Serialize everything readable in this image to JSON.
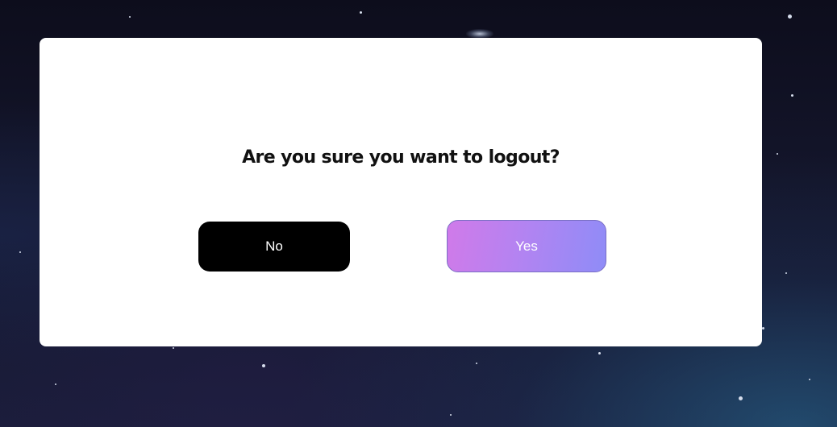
{
  "dialog": {
    "message": "Are you sure you want to logout?",
    "no_label": "No",
    "yes_label": "Yes"
  },
  "colors": {
    "no_button_bg": "#000000",
    "yes_button_gradient_start": "#d07ae9",
    "yes_button_gradient_end": "#8f8cf7",
    "modal_bg": "#ffffff",
    "backdrop": "#14162c"
  }
}
